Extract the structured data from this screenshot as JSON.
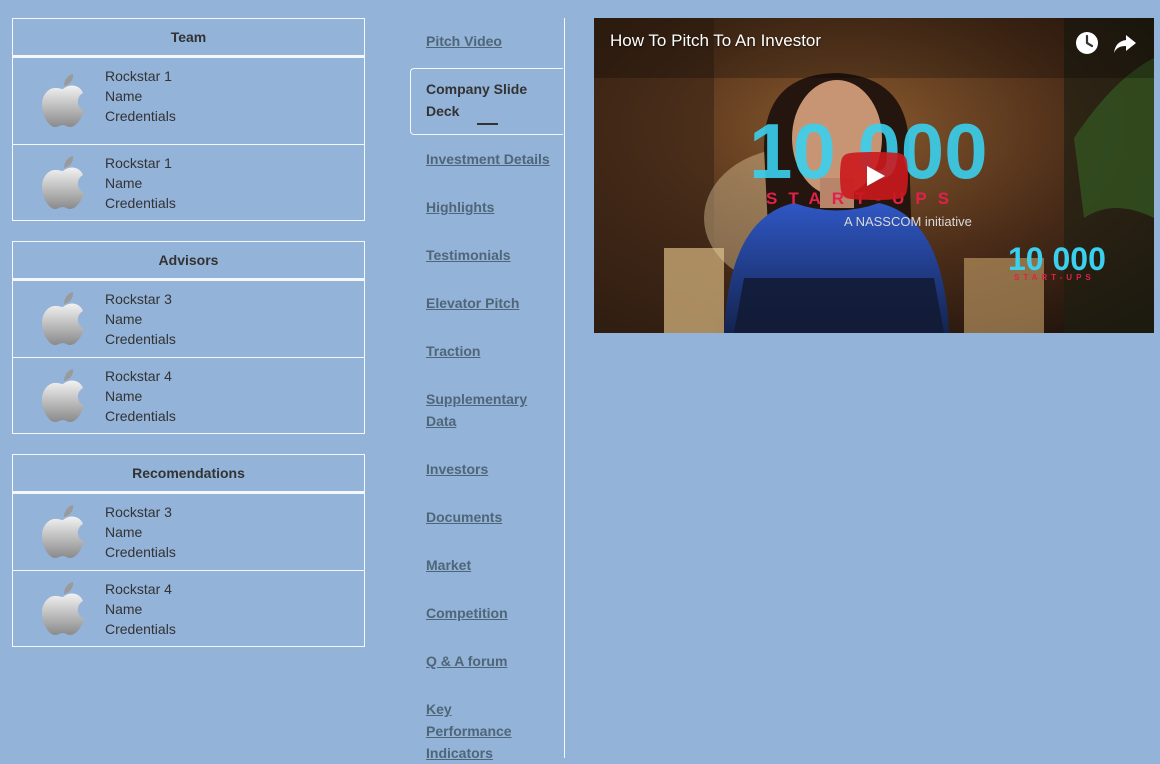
{
  "team": {
    "title": "Team",
    "members": [
      {
        "name_line": "Rockstar 1",
        "role_line": "Name",
        "cred_line": "Credentials"
      },
      {
        "name_line": "Rockstar 1",
        "role_line": "Name",
        "cred_line": "Credentials"
      }
    ]
  },
  "advisors": {
    "title": "Advisors",
    "members": [
      {
        "name_line": "Rockstar 3",
        "role_line": "Name",
        "cred_line": "Credentials"
      },
      {
        "name_line": "Rockstar 4",
        "role_line": "Name",
        "cred_line": "Credentials"
      }
    ]
  },
  "recommendations": {
    "title": "Recomendations",
    "members": [
      {
        "name_line": "Rockstar 3",
        "role_line": "Name",
        "cred_line": "Credentials"
      },
      {
        "name_line": "Rockstar 4",
        "role_line": "Name",
        "cred_line": "Credentials"
      }
    ]
  },
  "nav": {
    "items": [
      {
        "label": "Pitch Video"
      },
      {
        "label": "Company Slide Deck",
        "active": true
      },
      {
        "label": "Investment Details"
      },
      {
        "label": "Highlights"
      },
      {
        "label": "Testimonials"
      },
      {
        "label": "Elevator Pitch"
      },
      {
        "label": "Traction"
      },
      {
        "label": "Supplementary Data"
      },
      {
        "label": "Investors"
      },
      {
        "label": "Documents"
      },
      {
        "label": "Market"
      },
      {
        "label": "Competition"
      },
      {
        "label": "Q & A forum"
      },
      {
        "label": "Key Performance Indicators"
      }
    ]
  },
  "video": {
    "title": "How To Pitch To An Investor",
    "overlay_big": "10 000",
    "overlay_sub": "START-UPS",
    "overlay_initiative": "A NASSCOM initiative",
    "icons": {
      "watch_later": "clock-icon",
      "share": "share-icon",
      "play": "play-icon"
    }
  },
  "colors": {
    "page_bg": "#93b3d9",
    "border": "#f4f7fb",
    "link": "#4f6678",
    "youtube_red": "#cc181e"
  }
}
